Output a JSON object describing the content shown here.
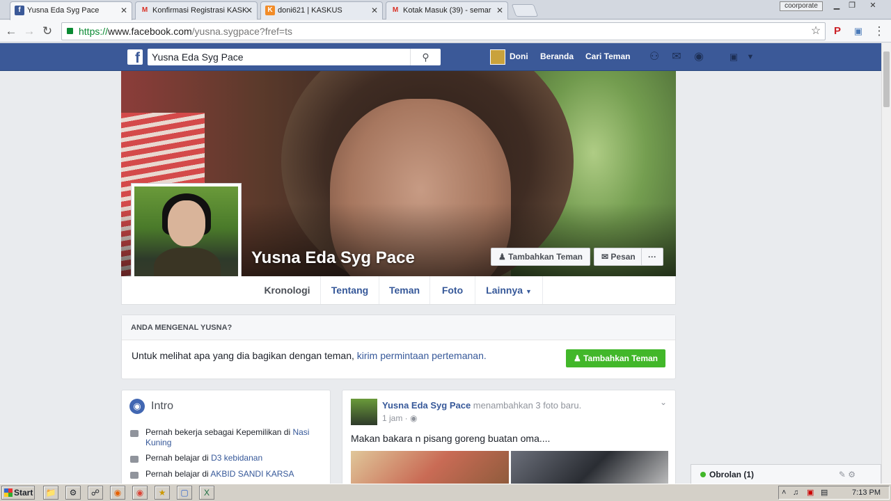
{
  "browser": {
    "tabs": [
      {
        "title": "Yusna Eda Syg Pace",
        "favicon": "facebook-icon",
        "favicon_glyph": "f",
        "favicon_color": "#3b5998",
        "active": true
      },
      {
        "title": "Konfirmasi Registrasi KASK",
        "favicon": "gmail-icon",
        "favicon_glyph": "M",
        "favicon_color": "#d93025",
        "active": false
      },
      {
        "title": "doni621 | KASKUS",
        "favicon": "kaskus-icon",
        "favicon_glyph": "K",
        "favicon_color": "#f28c28",
        "active": false
      },
      {
        "title": "Kotak Masuk (39) - semar",
        "favicon": "gmail-icon",
        "favicon_glyph": "M",
        "favicon_color": "#d93025",
        "active": false
      }
    ],
    "profile_label": "coorporate",
    "url_scheme": "https://",
    "url_host": "www.facebook.com",
    "url_path": "/yusna.sygpace?fref=ts"
  },
  "fb_header": {
    "logo": "f",
    "search_value": "Yusna Eda Syg Pace",
    "user_name": "Doni",
    "home_label": "Beranda",
    "find_friends_label": "Cari Teman",
    "brand_color": "#3b5998"
  },
  "profile": {
    "name": "Yusna Eda Syg Pace",
    "add_friend_label": "Tambahkan Teman",
    "message_label": "Pesan",
    "more_label": "···",
    "tabs": [
      "Kronologi",
      "Tentang",
      "Teman",
      "Foto",
      "Lainnya"
    ]
  },
  "know_card": {
    "header": "ANDA MENGENAL YUSNA?",
    "message": "Untuk melihat apa yang dia bagikan dengan teman, ",
    "link": "kirim permintaan pertemanan.",
    "button_label": "Tambahkan Teman",
    "button_color": "#42b72a"
  },
  "intro": {
    "title": "Intro",
    "items": [
      {
        "prefix": "Pernah bekerja sebagai Kepemilikan di ",
        "link": "Nasi Kuning"
      },
      {
        "prefix": "Pernah belajar di ",
        "link": "D3 kebidanan"
      },
      {
        "prefix": "Pernah belajar di ",
        "link": "AKBID SANDI KARSA"
      }
    ]
  },
  "post": {
    "author": "Yusna Eda Syg Pace",
    "action": " menambahkan 3 foto baru.",
    "time": "1 jam · ",
    "text": "Makan bakara n pisang goreng buatan oma...."
  },
  "chat": {
    "label": "Obrolan (1)"
  },
  "taskbar": {
    "start_label": "Start",
    "clock": "7:13 PM"
  }
}
